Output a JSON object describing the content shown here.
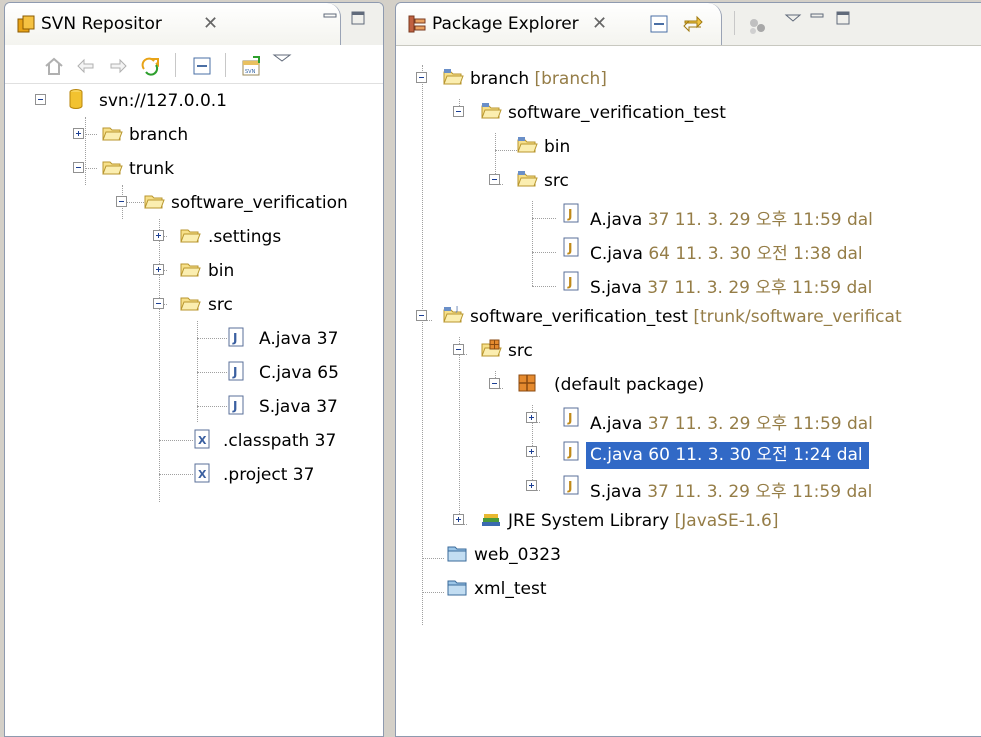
{
  "svn_view": {
    "tab_title": "SVN Repositor",
    "tree": {
      "root": "svn://127.0.0.1",
      "branch": "branch",
      "trunk": "trunk",
      "project": "software_verification",
      "settings": ".settings",
      "bin": "bin",
      "src": "src",
      "a_java": "A.java 37",
      "c_java": "C.java 65",
      "s_java": "S.java 37",
      "classpath": ".classpath 37",
      "project_file": ".project 37"
    }
  },
  "pkg_view": {
    "tab_title": "Package Explorer",
    "tree": {
      "branch_name": "branch",
      "branch_deco": "[branch]",
      "branch_project": "software_verification_test",
      "branch_bin": "bin",
      "branch_src": "src",
      "b_a_name": "A.java",
      "b_a_deco": "37  11. 3. 29 오후 11:59  dal",
      "b_c_name": "C.java",
      "b_c_deco": "64  11. 3. 30 오전 1:38  dal",
      "b_s_name": "S.java",
      "b_s_deco": "37  11. 3. 29 오후 11:59  dal",
      "project_name": "software_verification_test",
      "project_deco": "[trunk/software_verificat",
      "src": "src",
      "default_package": "(default package)",
      "a_name": "A.java",
      "a_deco": "37  11. 3. 29 오후 11:59  dal",
      "c_selected": "C.java 60  11. 3. 30 오전 1:24  dal",
      "s_name": "S.java",
      "s_deco": "37  11. 3. 29 오후 11:59  dal",
      "jre_name": "JRE System Library",
      "jre_deco": "[JavaSE-1.6]",
      "web": "web_0323",
      "xml": "xml_test"
    }
  },
  "colors": {
    "decoration": "#957d47",
    "selection": "#3169c6"
  }
}
